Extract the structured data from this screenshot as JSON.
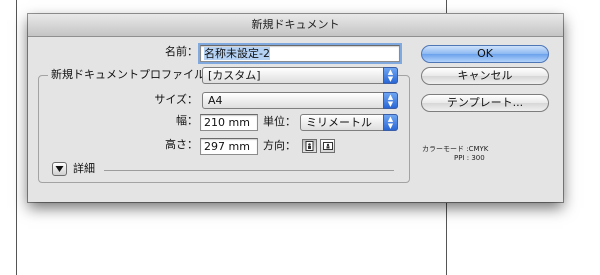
{
  "dialog": {
    "title": "新規ドキュメント",
    "name": {
      "label": "名前：",
      "value": "名称未設定-2"
    },
    "profile": {
      "label": "新規ドキュメントプロファイル：",
      "value": "[カスタム]"
    },
    "size": {
      "label": "サイズ：",
      "value": "A4"
    },
    "width": {
      "label": "幅：",
      "value": "210 mm"
    },
    "height": {
      "label": "高さ：",
      "value": "297 mm"
    },
    "units": {
      "label": "単位：",
      "value": "ミリメートル"
    },
    "orientation": {
      "label": "方向：",
      "selected": "portrait"
    },
    "advanced": {
      "label": "詳細"
    },
    "buttons": {
      "ok": "OK",
      "cancel": "キャンセル",
      "templates": "テンプレート..."
    },
    "info": {
      "color_mode": "カラーモード :CMYK",
      "ppi": "PPI : 300"
    },
    "accent_color": "#4a8ae8"
  }
}
